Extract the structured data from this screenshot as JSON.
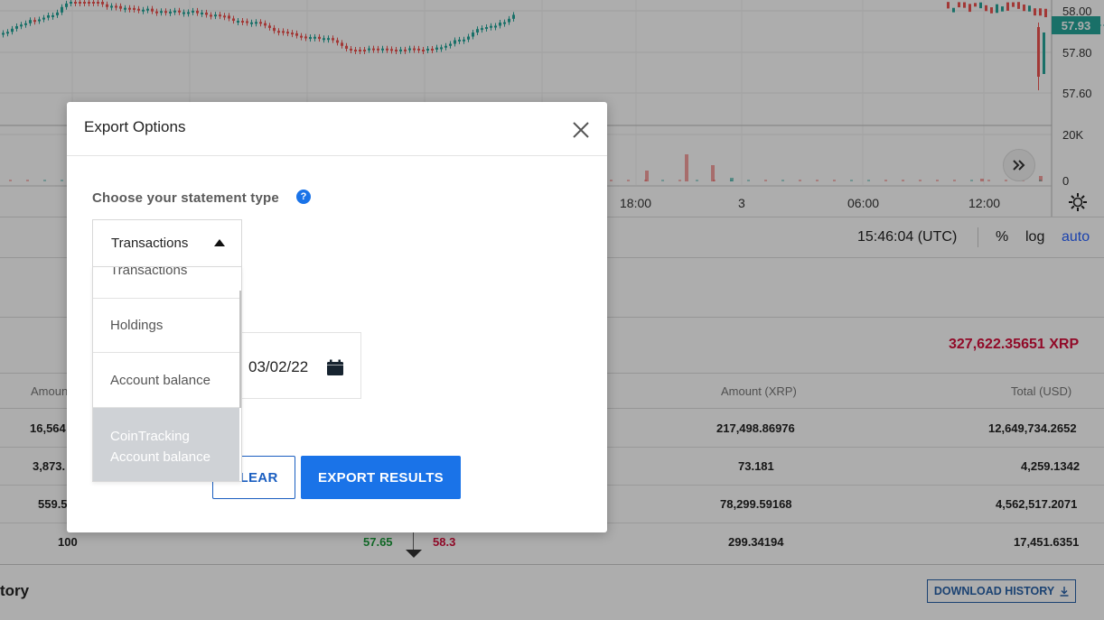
{
  "chart": {
    "price_labels": [
      "58.00",
      "57.80",
      "57.60"
    ],
    "current_price": "57.93",
    "volume_labels": [
      "20K",
      "0"
    ],
    "time_labels": [
      "18:00",
      "3",
      "06:00",
      "12:00"
    ],
    "scroll_icon": "double-chevron-right-icon",
    "settings_icon": "gear-icon",
    "colors": {
      "up": "#26a69a",
      "down": "#ef5350"
    }
  },
  "toolbar": {
    "clock": "15:46:04 (UTC)",
    "percent": "%",
    "log": "log",
    "auto": "auto"
  },
  "balance": {
    "total": "327,622.35651 XRP"
  },
  "table": {
    "headers": {
      "amount": "Amoun",
      "amount_xrp": "Amount (XRP)",
      "total_usd": "Total (USD)"
    },
    "rows": [
      {
        "amount": "16,564",
        "amount_xrp": "217,498.86976",
        "total_usd": "12,649,734.2652"
      },
      {
        "amount": "3,873.",
        "amount_xrp": "73.181",
        "total_usd": "4,259.1342"
      },
      {
        "amount": "559.5",
        "amount_xrp": "78,299.59168",
        "total_usd": "4,562,517.2071"
      },
      {
        "amount": "100",
        "amount_xrp": "299.34194",
        "total_usd": "17,451.6351"
      }
    ],
    "spread_green": "57.65",
    "spread_red": "58.3"
  },
  "history": {
    "title": "tory",
    "download_label": "DOWNLOAD HISTORY",
    "download_icon": "download-icon"
  },
  "modal": {
    "title": "Export Options",
    "close_icon": "close-icon",
    "statement_label": "Choose your statement type",
    "help_icon_glyph": "?",
    "selected_type": "Transactions",
    "options": [
      "Transactions",
      "Holdings",
      "Account balance",
      "CoinTracking Account balance"
    ],
    "date_value": "03/02/22",
    "calendar_icon": "calendar-icon",
    "clear_label": "CLEAR",
    "export_label": "EXPORT RESULTS"
  }
}
